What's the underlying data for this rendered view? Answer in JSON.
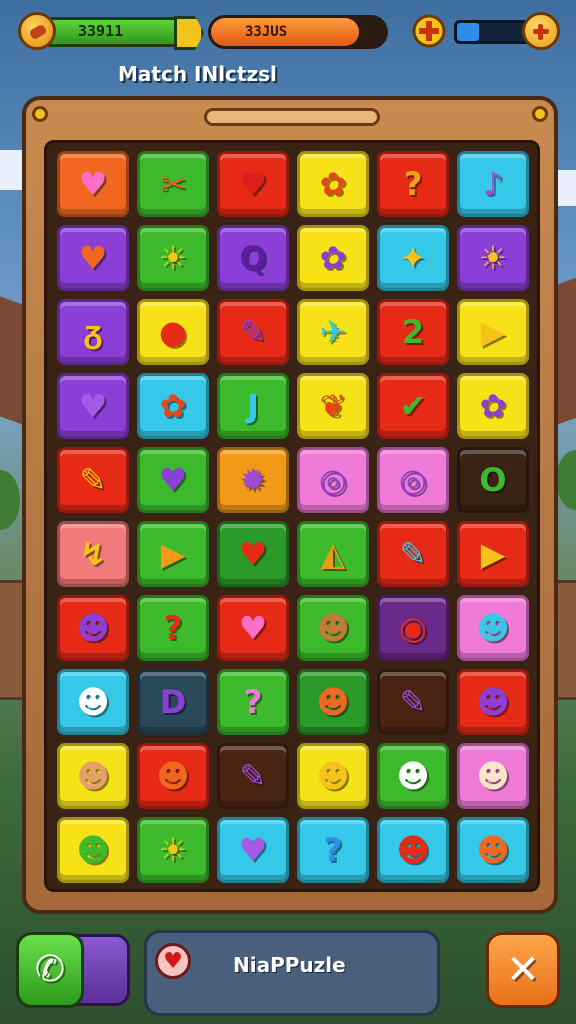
{
  "hud": {
    "coins": "33911",
    "energy": "33JUS",
    "energy_fill": 0.85,
    "gems_fill": 0.3,
    "icons": {
      "coin": "coin-icon",
      "gem": "gem-icon",
      "plus": "plus-icon"
    }
  },
  "title": "Match INlctzsl",
  "board": {
    "rows": [
      [
        {
          "c": "#f2671f",
          "g": "♥",
          "gc": "#ff6ec7"
        },
        {
          "c": "#3cba2c",
          "g": "✂",
          "gc": "#d9632a"
        },
        {
          "c": "#e62a16",
          "g": "♥",
          "gc": "#d9201a"
        },
        {
          "c": "#f7e218",
          "g": "✿",
          "gc": "#e6471a"
        },
        {
          "c": "#e62a16",
          "g": "?",
          "gc": "#f1a21a"
        },
        {
          "c": "#35c8e8",
          "g": "♪",
          "gc": "#a04ad8"
        }
      ],
      [
        {
          "c": "#8b3fd6",
          "g": "♥",
          "gc": "#f2671f"
        },
        {
          "c": "#3cba2c",
          "g": "☀",
          "gc": "#f7c21a"
        },
        {
          "c": "#8b3fd6",
          "g": "Q",
          "gc": "#5a1fa0"
        },
        {
          "c": "#f7e218",
          "g": "✿",
          "gc": "#8b3fd6"
        },
        {
          "c": "#35c8e8",
          "g": "✦",
          "gc": "#f7c21a"
        },
        {
          "c": "#8b3fd6",
          "g": "☀",
          "gc": "#f7c21a"
        }
      ],
      [
        {
          "c": "#8b3fd6",
          "g": "ᵹ",
          "gc": "#f7c21a"
        },
        {
          "c": "#f7e218",
          "g": "●",
          "gc": "#e62a16"
        },
        {
          "c": "#e62a16",
          "g": "✎",
          "gc": "#8b3fd6"
        },
        {
          "c": "#f7e218",
          "g": "✈",
          "gc": "#35c8e8"
        },
        {
          "c": "#e62a16",
          "g": "2",
          "gc": "#3cba2c"
        },
        {
          "c": "#f7e218",
          "g": "▶",
          "gc": "#f7c21a"
        }
      ],
      [
        {
          "c": "#8b3fd6",
          "g": "♥",
          "gc": "#a65ae6"
        },
        {
          "c": "#35c8e8",
          "g": "✿",
          "gc": "#e6471a"
        },
        {
          "c": "#3cba2c",
          "g": "J",
          "gc": "#35c8e8"
        },
        {
          "c": "#f7e218",
          "g": "❦",
          "gc": "#e6471a"
        },
        {
          "c": "#e62a16",
          "g": "✔",
          "gc": "#3cba2c"
        },
        {
          "c": "#f7e218",
          "g": "✿",
          "gc": "#8b3fd6"
        }
      ],
      [
        {
          "c": "#e62a16",
          "g": "✎",
          "gc": "#f7c21a"
        },
        {
          "c": "#3cba2c",
          "g": "♥",
          "gc": "#8b3fd6"
        },
        {
          "c": "#f29a18",
          "g": "✹",
          "gc": "#a04ad8"
        },
        {
          "c": "#f07ad8",
          "g": "◎",
          "gc": "#8b3fd6"
        },
        {
          "c": "#f07ad8",
          "g": "◎",
          "gc": "#8b3fd6"
        },
        {
          "c": "#3a2214",
          "g": "O",
          "gc": "#3cba2c"
        }
      ],
      [
        {
          "c": "#f27a7a",
          "g": "↯",
          "gc": "#f7c21a"
        },
        {
          "c": "#3cba2c",
          "g": "▶",
          "gc": "#f29a18"
        },
        {
          "c": "#2c9a28",
          "g": "♥",
          "gc": "#e62a16"
        },
        {
          "c": "#3cba2c",
          "g": "◭",
          "gc": "#f29a18"
        },
        {
          "c": "#e62a16",
          "g": "✎",
          "gc": "#35c8e8"
        },
        {
          "c": "#e62a16",
          "g": "▶",
          "gc": "#f7c21a"
        }
      ],
      [
        {
          "c": "#e62a16",
          "g": "☻",
          "gc": "#8b3fd6"
        },
        {
          "c": "#3cba2c",
          "g": "?",
          "gc": "#e62a16"
        },
        {
          "c": "#e62a16",
          "g": "♥",
          "gc": "#ff6ec7"
        },
        {
          "c": "#3cba2c",
          "g": "☻",
          "gc": "#c07a3a"
        },
        {
          "c": "#6a2a8a",
          "g": "◉",
          "gc": "#e62a16"
        },
        {
          "c": "#f07ad8",
          "g": "☻",
          "gc": "#35c8e8"
        }
      ],
      [
        {
          "c": "#35c8e8",
          "g": "☻",
          "gc": "#ffffff"
        },
        {
          "c": "#2a4a5a",
          "g": "D",
          "gc": "#8b3fd6"
        },
        {
          "c": "#3cba2c",
          "g": "?",
          "gc": "#f07ad8"
        },
        {
          "c": "#2c9a28",
          "g": "☻",
          "gc": "#f2671f"
        },
        {
          "c": "#4a2412",
          "g": "✎",
          "gc": "#a04ad8"
        },
        {
          "c": "#e62a16",
          "g": "☻",
          "gc": "#8b3fd6"
        }
      ],
      [
        {
          "c": "#f7e218",
          "g": "☻",
          "gc": "#e8a06a"
        },
        {
          "c": "#e62a16",
          "g": "☻",
          "gc": "#f2671f"
        },
        {
          "c": "#4a2412",
          "g": "✎",
          "gc": "#a04ad8"
        },
        {
          "c": "#f7e218",
          "g": "☻",
          "gc": "#f7c21a"
        },
        {
          "c": "#3cba2c",
          "g": "☻",
          "gc": "#ffffff"
        },
        {
          "c": "#f07ad8",
          "g": "☻",
          "gc": "#fde6c8"
        }
      ],
      [
        {
          "c": "#f7e218",
          "g": "☻",
          "gc": "#3cba2c"
        },
        {
          "c": "#3cba2c",
          "g": "☀",
          "gc": "#f7c21a"
        },
        {
          "c": "#35c8e8",
          "g": "♥",
          "gc": "#a65ae6"
        },
        {
          "c": "#35c8e8",
          "g": "?",
          "gc": "#2e8de6"
        },
        {
          "c": "#35c8e8",
          "g": "☻",
          "gc": "#e62a16"
        },
        {
          "c": "#35c8e8",
          "g": "☻",
          "gc": "#f2671f"
        }
      ]
    ]
  },
  "bottom": {
    "message": "NiaPPuzle",
    "phone_icon": "phone-icon",
    "heart_icon": "heart-icon",
    "close_icon": "close-icon"
  }
}
